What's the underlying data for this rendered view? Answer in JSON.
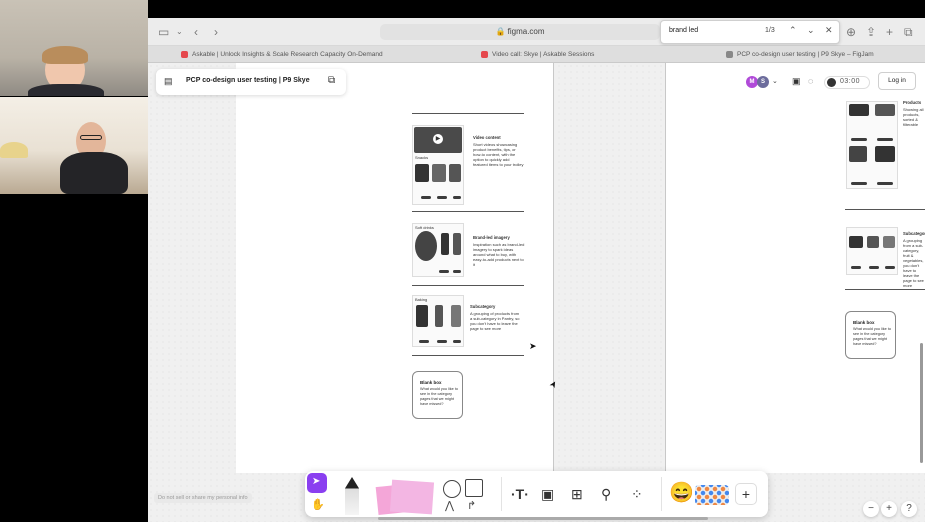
{
  "browser": {
    "url": "figma.com",
    "find": {
      "query": "brand led",
      "count": "1/3"
    },
    "tabs": [
      {
        "label": "Askable | Unlock Insights & Scale Research Capacity On-Demand",
        "color": "#e5484d"
      },
      {
        "label": "Video call: Skye | Askable Sessions",
        "color": "#e5484d"
      },
      {
        "label": "PCP co-design user testing | P9 Skye – FigJam",
        "color": "#888888"
      }
    ]
  },
  "figjam": {
    "file_title": "PCP co-design user testing | P9 Skye",
    "login_label": "Log in",
    "timer": "03:00",
    "avatars": [
      {
        "initial": "M",
        "color": "#b04ad8"
      },
      {
        "initial": "S",
        "color": "#6c6c9c"
      }
    ],
    "privacy_note": "Do not sell or share my personal info",
    "zoom_out": "−",
    "zoom_in": "+",
    "help": "?"
  },
  "board_left": {
    "sections": [
      {
        "heading": "Video content",
        "body": "Short videos showcasing product benefits, tips, or how-to content, with the option to quickly add featured items to your trolley",
        "img_label": "Snacks"
      },
      {
        "heading": "Brand-led imagery",
        "body": "Inspiration such as brand-led imagery to spark ideas around what to buy, with easy-to-add products next to it",
        "img_label": "Soft drinks"
      },
      {
        "heading": "Subcategory",
        "body": "A grouping of products from a sub-category in Pantry, so you don't have to leave the page to see more",
        "img_label": "Baking"
      }
    ],
    "blank_box": {
      "heading": "Blank box",
      "body": "What would you like to see in the category pages that we might have missed?"
    }
  },
  "board_right": {
    "sections": [
      {
        "heading": "Products",
        "body": "Showing all products, sorted & filterable"
      },
      {
        "heading": "Subcategory",
        "body": "A grouping from a sub-category, fruit & vegetables, you don't have to leave the page to see more"
      }
    ],
    "blank_box": {
      "heading": "Blank box",
      "body": "What would you like to see in the category pages that we might have missed?"
    }
  }
}
